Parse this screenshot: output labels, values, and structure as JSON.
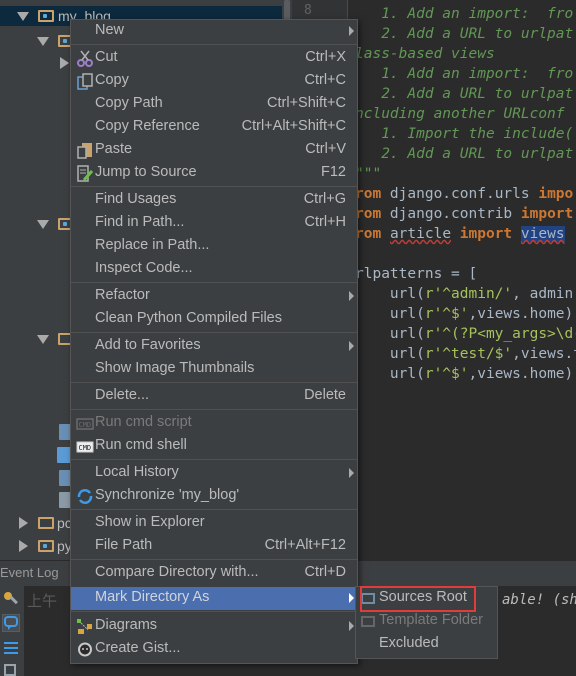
{
  "project_tree": {
    "root_label": "my_blog",
    "partial_labels": [
      "pc",
      "py"
    ]
  },
  "editor": {
    "line_number": "8",
    "lines": [
      {
        "type": "comment",
        "text": "   1. Add an import:  fro"
      },
      {
        "type": "comment",
        "text": "   2. Add a URL to urlpat"
      },
      {
        "type": "comment",
        "text": "lass-based views"
      },
      {
        "type": "comment",
        "text": "   1. Add an import:  fro"
      },
      {
        "type": "comment",
        "text": "   2. Add a URL to urlpat"
      },
      {
        "type": "comment",
        "text": "ncluding another URLconf"
      },
      {
        "type": "comment",
        "text": "   1. Import the include("
      },
      {
        "type": "comment",
        "text": "   2. Add a URL to urlpat"
      },
      {
        "type": "comment",
        "text": "\"\"\""
      }
    ],
    "code": {
      "import1_kw": "rom",
      "import1_mod": " django.conf.urls ",
      "import1_imp": "impo",
      "import2_kw": "rom",
      "import2_mod": " django.contrib ",
      "import2_imp": "import",
      "import3_kw": "rom",
      "import3_mod": "article",
      "import3_imp": "import",
      "import3_name": "views",
      "urlpatterns": "rlpatterns = [",
      "url1_a": "    url(",
      "url1_s": "r'^admin/'",
      "url1_b": ", admin",
      "url2_a": "    url(",
      "url2_s": "r'^$'",
      "url2_b": ",views.home)",
      "url3_a": "    url(",
      "url3_s": "r'^(?P<my_args>\\d-",
      "url3_b": "",
      "url4_a": "    url(",
      "url4_s": "r'^test/$'",
      "url4_b": ",views.t",
      "url5_a": "    url(",
      "url5_s": "r'^$'",
      "url5_b": ",views.home)"
    }
  },
  "event_log": {
    "title": "Event Log",
    "time_prefix": "上午",
    "message_fragment": "able! (sh"
  },
  "context_menu": {
    "items": [
      {
        "label": "New",
        "shortcut": "",
        "submenu": true
      },
      {
        "label": "Cut",
        "shortcut": "Ctrl+X",
        "icon": "scissors-icon"
      },
      {
        "label": "Copy",
        "shortcut": "Ctrl+C",
        "icon": "copy-icon"
      },
      {
        "label": "Copy Path",
        "shortcut": "Ctrl+Shift+C"
      },
      {
        "label": "Copy Reference",
        "shortcut": "Ctrl+Alt+Shift+C"
      },
      {
        "label": "Paste",
        "shortcut": "Ctrl+V",
        "icon": "paste-icon"
      },
      {
        "label": "Jump to Source",
        "shortcut": "F12",
        "icon": "jump-to-source-icon"
      },
      {
        "label": "Find Usages",
        "shortcut": "Ctrl+G"
      },
      {
        "label": "Find in Path...",
        "shortcut": "Ctrl+H"
      },
      {
        "label": "Replace in Path...",
        "shortcut": ""
      },
      {
        "label": "Inspect Code...",
        "shortcut": ""
      },
      {
        "label": "Refactor",
        "shortcut": "",
        "submenu": true
      },
      {
        "label": "Clean Python Compiled Files",
        "shortcut": ""
      },
      {
        "label": "Add to Favorites",
        "shortcut": "",
        "submenu": true
      },
      {
        "label": "Show Image Thumbnails",
        "shortcut": ""
      },
      {
        "label": "Delete...",
        "shortcut": "Delete"
      },
      {
        "label": "Run cmd script",
        "shortcut": "",
        "disabled": true,
        "icon": "cmd-icon"
      },
      {
        "label": "Run cmd shell",
        "shortcut": "",
        "icon": "cmd-icon"
      },
      {
        "label": "Local History",
        "shortcut": "",
        "submenu": true
      },
      {
        "label": "Synchronize 'my_blog'",
        "shortcut": "",
        "icon": "sync-icon"
      },
      {
        "label": "Show in Explorer",
        "shortcut": ""
      },
      {
        "label": "File Path",
        "shortcut": "Ctrl+Alt+F12"
      },
      {
        "label": "Compare Directory with...",
        "shortcut": "Ctrl+D"
      },
      {
        "label": "Mark Directory As",
        "shortcut": "",
        "submenu": true,
        "active": true
      },
      {
        "label": "Diagrams",
        "shortcut": "",
        "submenu": true,
        "icon": "diagrams-icon"
      },
      {
        "label": "Create Gist...",
        "shortcut": "",
        "icon": "github-icon"
      }
    ]
  },
  "submenu": {
    "items": [
      {
        "label": "Sources Root",
        "highlighted": true
      },
      {
        "label": "Template Folder",
        "disabled": true
      },
      {
        "label": "Excluded"
      }
    ]
  },
  "colors": {
    "menu_bg": "#3c3f41",
    "active_item": "#4b6eaf",
    "highlight_box": "#e03c3c",
    "editor_bg": "#2b2b2b"
  }
}
